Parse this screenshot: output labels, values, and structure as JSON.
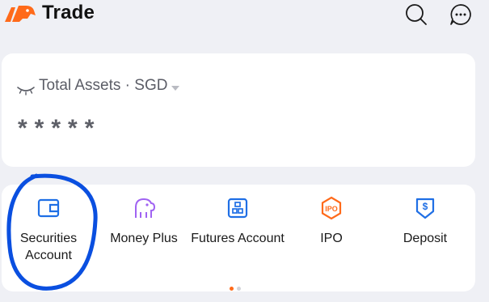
{
  "header": {
    "title": "Trade",
    "logo_icon": "bull-logo-icon",
    "actions": [
      {
        "icon": "search-icon"
      },
      {
        "icon": "more-chat-icon"
      }
    ]
  },
  "assets": {
    "label": "Total Assets · SGD",
    "currency_dropdown": "chevron-down-icon",
    "visibility_icon": "eye-closed-icon",
    "masked_value": "*****"
  },
  "menu": {
    "items": [
      {
        "label": "Securities Account",
        "icon": "wallet-icon"
      },
      {
        "label": "Money Plus",
        "icon": "piggy-bank-icon"
      },
      {
        "label": "Futures Account",
        "icon": "futures-icon"
      },
      {
        "label": "IPO",
        "icon": "ipo-icon"
      },
      {
        "label": "Deposit",
        "icon": "deposit-icon"
      }
    ],
    "page_indicator": {
      "current": 1,
      "total": 2
    }
  },
  "colors": {
    "background": "#eff0f5",
    "card": "#ffffff",
    "brand_orange": "#ff6a1a",
    "accent_blue": "#1f6fe5",
    "purple": "#a063f2",
    "annotation_ink": "#0a4fe0"
  }
}
